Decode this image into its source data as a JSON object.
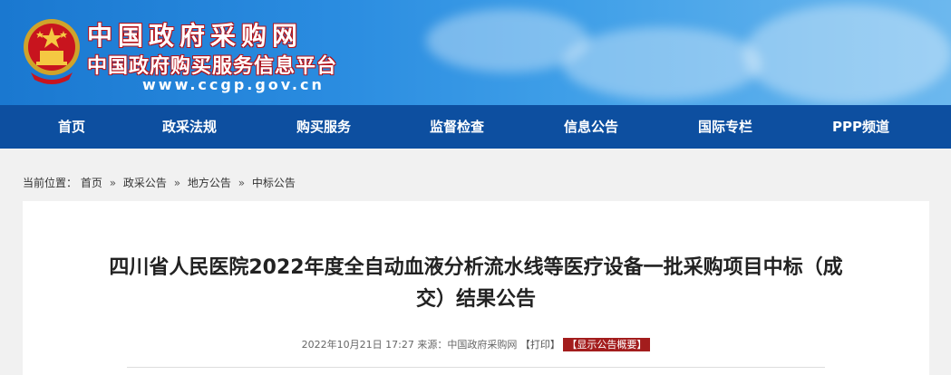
{
  "header": {
    "site_title": "中国政府采购网",
    "site_subtitle": "中国政府购买服务信息平台",
    "site_url": "www.ccgp.gov.cn"
  },
  "nav": {
    "items": [
      {
        "label": "首页"
      },
      {
        "label": "政采法规"
      },
      {
        "label": "购买服务"
      },
      {
        "label": "监督检查"
      },
      {
        "label": "信息公告"
      },
      {
        "label": "国际专栏"
      },
      {
        "label": "PPP频道"
      }
    ]
  },
  "breadcrumb": {
    "prefix": "当前位置：",
    "items": [
      "首页",
      "政采公告",
      "地方公告",
      "中标公告"
    ],
    "separator": "»"
  },
  "article": {
    "title_line1": "四川省人民医院2022年度全自动血液分析流水线等医疗设备一批采购项目中标（成",
    "title_line2": "交）结果公告",
    "date": "2022年10月21日 17:27",
    "source_label": "来源：",
    "source": "中国政府采购网",
    "print_label": "【打印】",
    "summary_label": "【显示公告概要】"
  },
  "colors": {
    "banner_blue": "#1a78d0",
    "nav_blue": "#0d4fa0",
    "summary_red": "#a31d1d"
  }
}
